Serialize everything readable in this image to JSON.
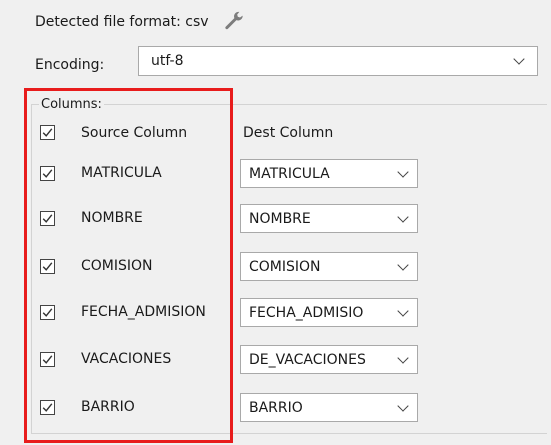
{
  "detected": {
    "text": "Detected file format: csv",
    "icon": "wrench-icon"
  },
  "encoding": {
    "label": "Encoding:",
    "value": "utf-8"
  },
  "columns": {
    "group_title": "Columns:",
    "header_source": "Source Column",
    "header_dest": "Dest Column",
    "header_checked": true,
    "rows": [
      {
        "source": "MATRICULA",
        "dest": "MATRICULA",
        "checked": true
      },
      {
        "source": "NOMBRE",
        "dest": "NOMBRE",
        "checked": true
      },
      {
        "source": "COMISION",
        "dest": "COMISION",
        "checked": true
      },
      {
        "source": "FECHA_ADMISION",
        "dest": "FECHA_ADMISIO",
        "checked": true
      },
      {
        "source": "VACACIONES",
        "dest": "DE_VACACIONES",
        "checked": true
      },
      {
        "source": "BARRIO",
        "dest": "BARRIO",
        "checked": true
      }
    ]
  },
  "colors": {
    "highlight": "#e81c1c",
    "background": "#f0f0f0",
    "field_border": "#a9a9a9"
  }
}
